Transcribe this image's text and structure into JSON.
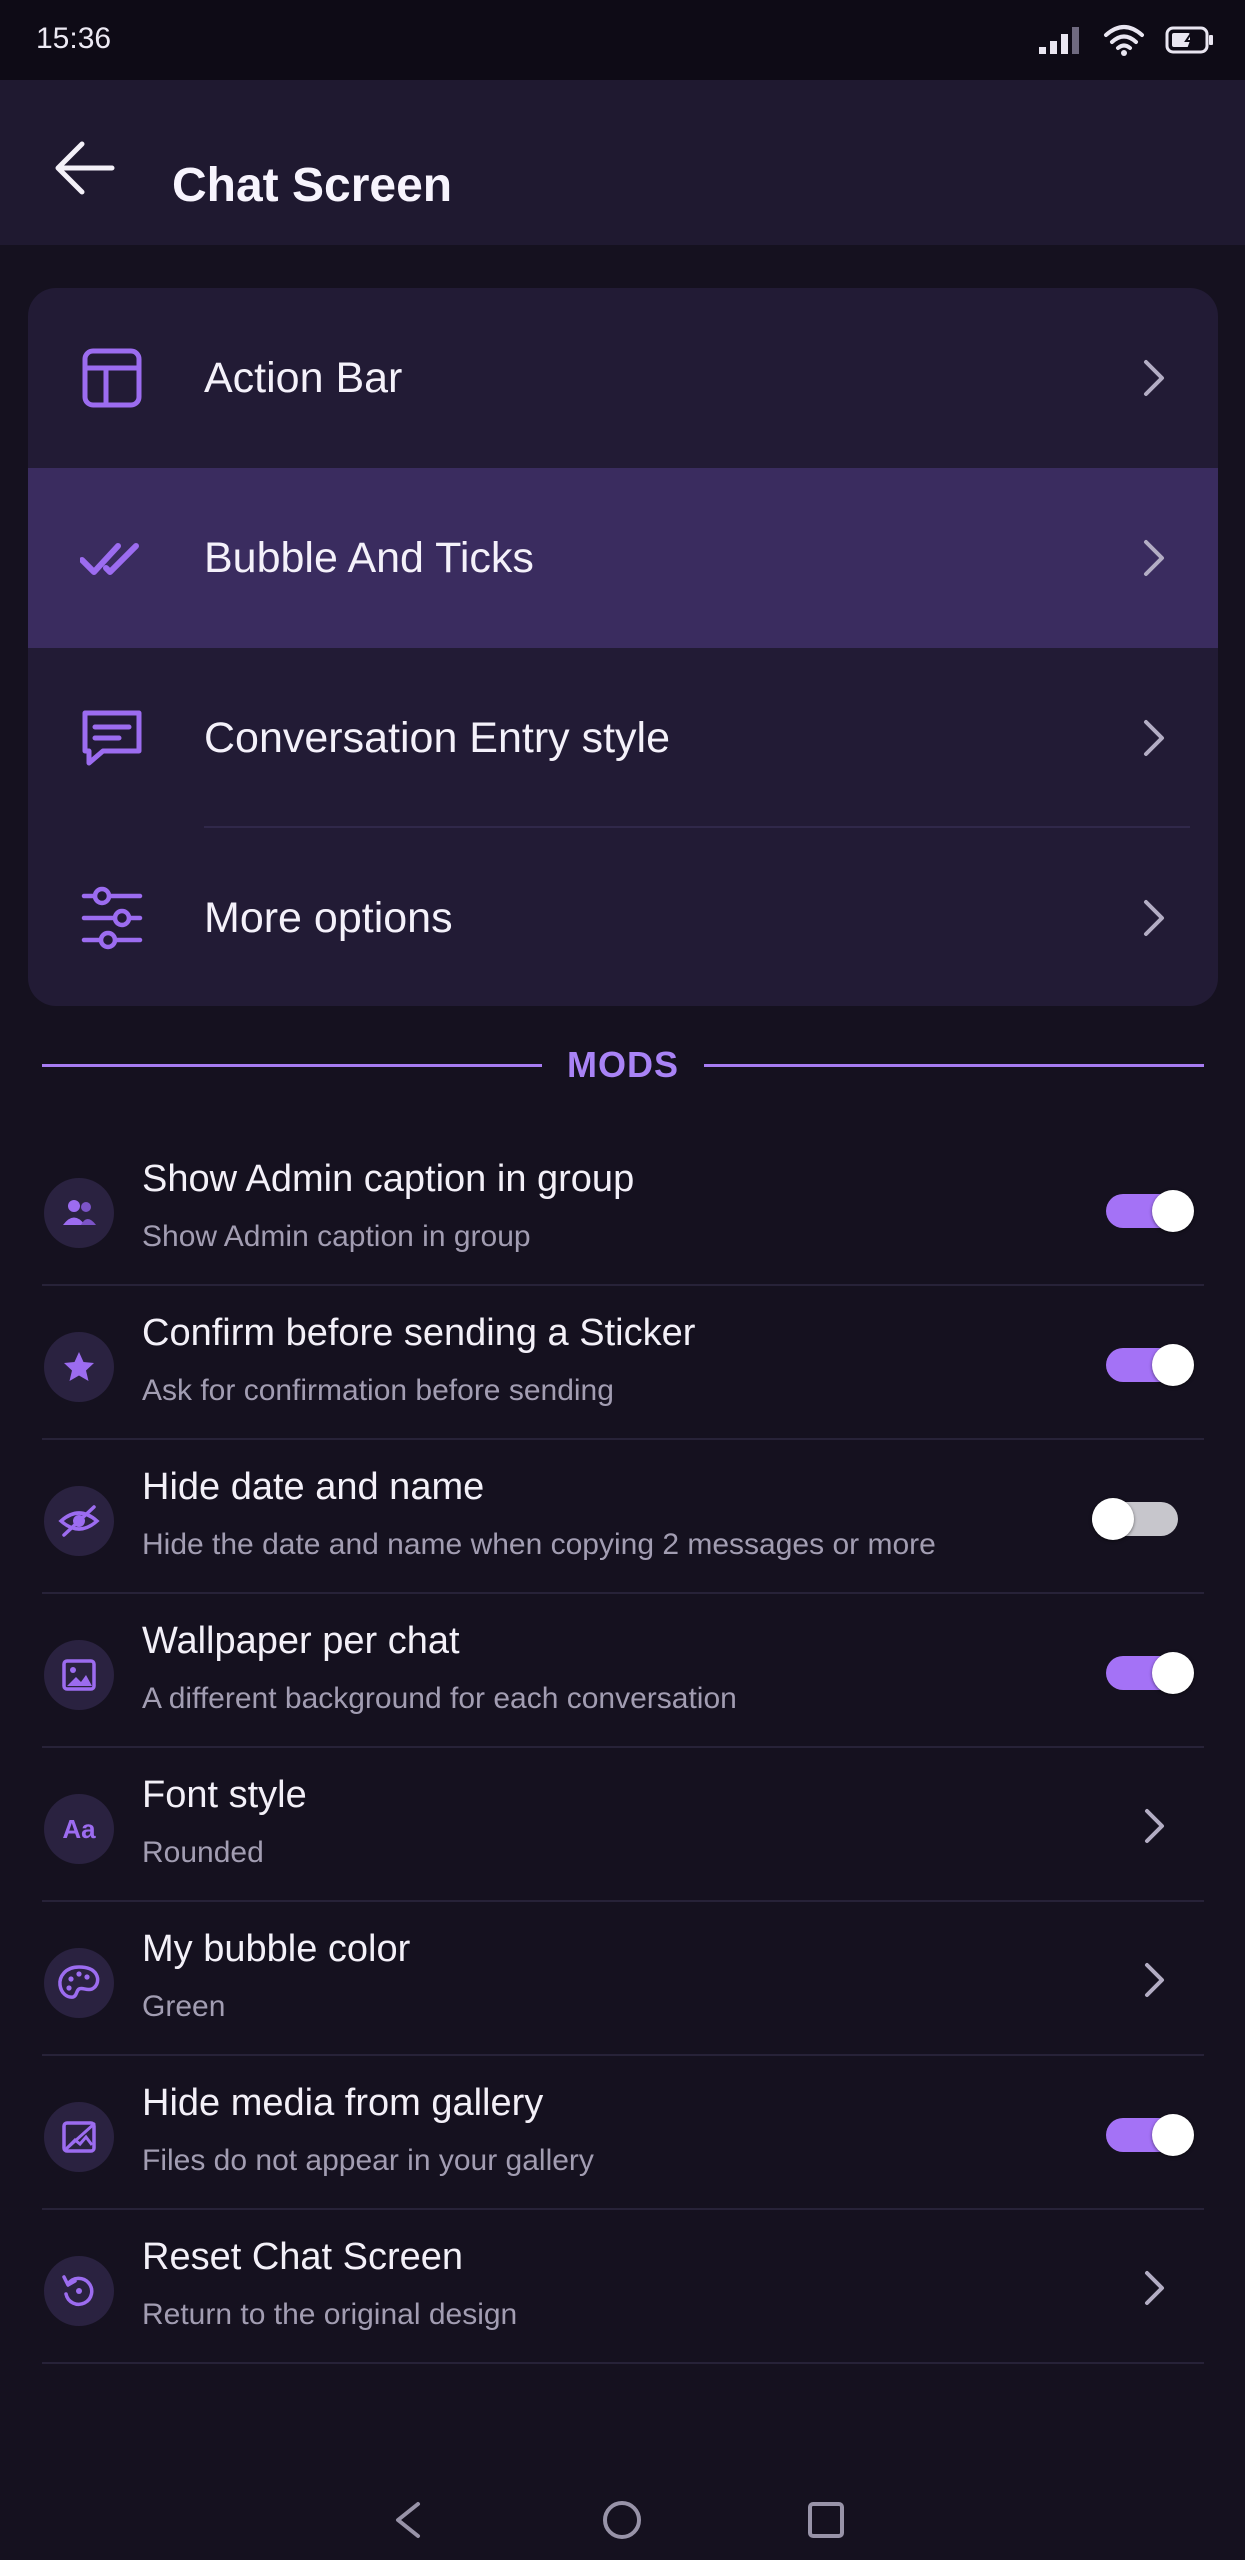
{
  "status": {
    "time": "15:36"
  },
  "header": {
    "title": "Chat Screen"
  },
  "menu": {
    "items": [
      {
        "label": "Action Bar",
        "icon": "layout-icon",
        "active": false
      },
      {
        "label": "Bubble And Ticks",
        "icon": "double-check-icon",
        "active": true
      },
      {
        "label": "Conversation Entry style",
        "icon": "chat-bubble-icon",
        "active": false
      },
      {
        "label": "More options",
        "icon": "sliders-icon",
        "active": false
      }
    ]
  },
  "section": {
    "title": "MODS"
  },
  "mods": [
    {
      "title": "Show Admin caption in group",
      "subtitle": "Show Admin caption in group",
      "icon": "users-icon",
      "control": "toggle",
      "on": true
    },
    {
      "title": "Confirm before sending a Sticker",
      "subtitle": "Ask for confirmation before sending",
      "icon": "star-icon",
      "control": "toggle",
      "on": true
    },
    {
      "title": "Hide date and name",
      "subtitle": "Hide the date and name when copying 2 messages or more",
      "icon": "eye-off-icon",
      "control": "toggle",
      "on": false
    },
    {
      "title": "Wallpaper per chat",
      "subtitle": "A different background for each conversation",
      "icon": "image-icon",
      "control": "toggle",
      "on": true
    },
    {
      "title": "Font style",
      "subtitle": "Rounded",
      "icon": "font-icon",
      "icon_text": "Aa",
      "control": "chevron"
    },
    {
      "title": "My bubble color",
      "subtitle": "Green",
      "icon": "palette-icon",
      "control": "chevron"
    },
    {
      "title": "Hide media from gallery",
      "subtitle": "Files do not appear in your gallery",
      "icon": "image-off-icon",
      "control": "toggle",
      "on": true
    },
    {
      "title": "Reset Chat Screen",
      "subtitle": "Return to the original design",
      "icon": "reset-icon",
      "control": "chevron"
    }
  ],
  "colors": {
    "background": "#15111f",
    "header": "#1f1930",
    "card": "#221b35",
    "active_row": "#3a2c5f",
    "accent": "#a472f6",
    "icon_accent": "#9c6cf0"
  }
}
